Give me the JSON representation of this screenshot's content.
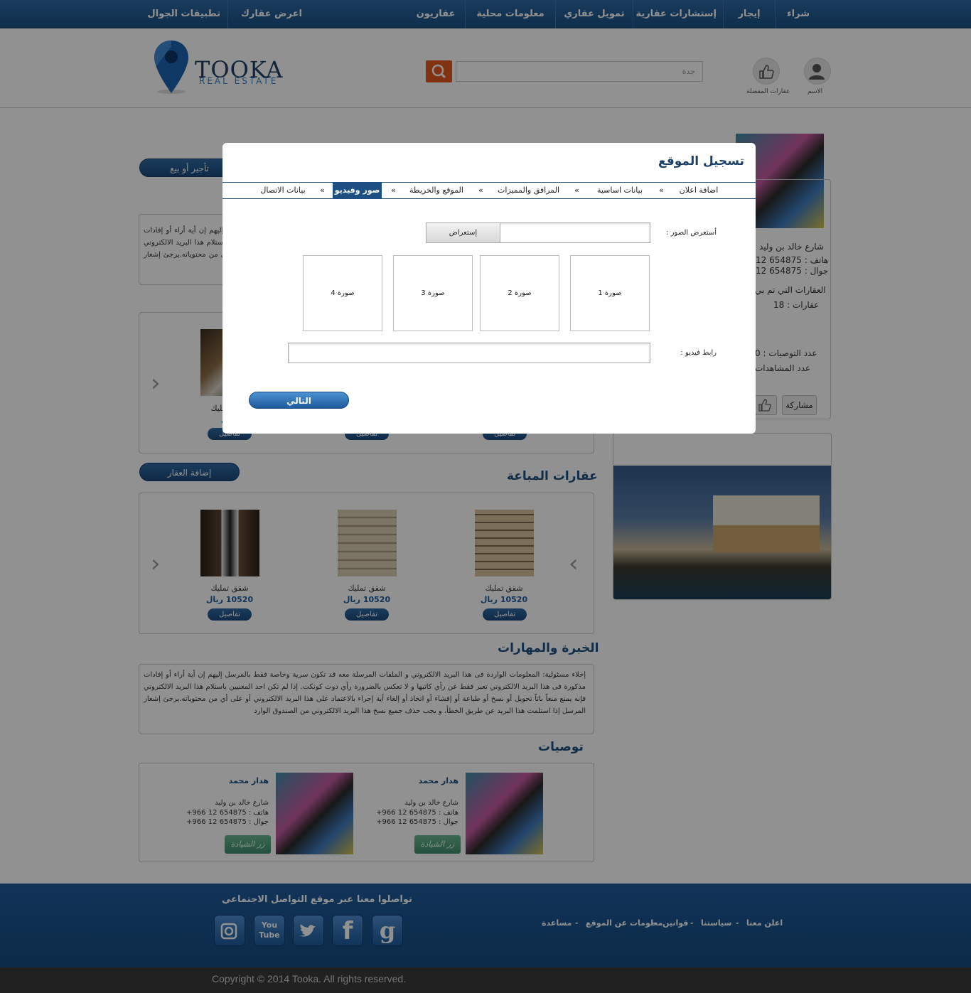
{
  "topnav": {
    "items": [
      "شراء",
      "إيجار",
      "إستشارات عقارية",
      "تمويل عقاري",
      "معلومات محلية",
      "عقاريون",
      "اعرض  عقارك",
      "تطبيقات الجوال"
    ]
  },
  "header": {
    "logo_main": "TOOKA",
    "logo_sub": "REAL ESTATE",
    "search_placeholder": "جدة",
    "user_label": "الاسم",
    "favorites_label": "عقارات المفضلة"
  },
  "main": {
    "rent_sell_button": "تأجير أو بيع",
    "add_property_button": "إضافة العقار",
    "sold_title": "عقارات المباعة",
    "experience_title": "الخبرة والمهارات",
    "recommendations_title": "توصيات",
    "disclaimer_text": "إخلاء مسئولية: المعلومات الواردة فى هذا البريد الالكتروني و الملفات المرسلة معه قد تكون سرية وخاصة فقط بالمرسل إليهم إن أية أراء أو إفادات مذكورة فى هذا البريد الالكتروني تعبر فقط عن رأي كاتبها و لا تعكس بالضرورة رأي دوت كونكت. إذا لم تكن احد المعنيين باستلام هذا البريد الالكتروني فإنه يمنع منعاً باتاً تحويل أو نسخ أو طباعة أو إفشاء أو اتخاذ أو إلغاء أية إجراء بالاعتماد على هذا البريد الالكتروني أو على أي من محتوياته.يرجئ إشعار المرسل إذا استلمت هذا البريد عن طريق الخطأ،  و يجب حذف جميع نسخ هذا البريد الالكتروني من الصندوق الوارد",
    "top_disclaimer_visible": "لمرسل إليهم إن أية أراء أو احد المعنيين باستلام هذا يد الالكتروني أو على أي كتروني من الصندوق الوارد",
    "properties": [
      {
        "name": "شقق تمليك",
        "price": "10520 ريال",
        "details": "تفاصيل"
      },
      {
        "name": "شقق تمليك",
        "price": "10520 ريال",
        "details": "تفاصيل"
      },
      {
        "name": "شقق تمليك",
        "price": "10520 ريال",
        "details": "تفاصيل"
      }
    ],
    "top_properties": [
      {
        "name": "شقق تمليك",
        "price": "ريال",
        "details": "تفاصيل"
      }
    ],
    "recommendations": [
      {
        "name": "هدار محمد",
        "street": "شارع خالد بن وليد",
        "phone": "هاتف : 654875 12 966+",
        "mobile": "جوال : 654875 12 966+",
        "visit": "زر الشيادة"
      },
      {
        "name": "هدار محمد",
        "street": "شارع خالد بن وليد",
        "phone": "هاتف : 654875 12 966+",
        "mobile": "جوال : 654875 12 966+",
        "visit": "زر الشيادة"
      }
    ]
  },
  "sidebar": {
    "street": "شارع خالد بن وليد",
    "phone": "هاتف : 654875 12",
    "mobile": "جوال : 654875 12",
    "sold_label": "العقارات التي تم بي",
    "properties_count": "عقارات  :   18",
    "recommend_count": "عدد التوصيات : 0",
    "views_count": "عدد المشاهدات",
    "share_button": "مشاركة"
  },
  "modal": {
    "title": "تسجيل الموقع",
    "tabs": [
      "اضافة اعلان",
      "بيانات اساسية",
      "المرافق والمميزات",
      "الموقع والخريطة",
      "صور وفيديو",
      "بيانات الاتصال"
    ],
    "active_tab": 4,
    "separator": "»",
    "browse_label": "أستعرض الصور :",
    "browse_button": "إستعراض",
    "photo_slots": [
      "صورة 1",
      "صورة 2",
      "صورة 3",
      "صورة 4"
    ],
    "video_label": "رابط فيديو :",
    "next_button": "التالي"
  },
  "footer": {
    "social_title": "تواصلوا معنا عبر موقع التواصل الاجتماعي",
    "links": [
      "اعلن معنا",
      "-",
      "سياستنا",
      "-",
      "قوانين",
      "-",
      "معلومات عن الموقع",
      "-",
      "مساعدة"
    ],
    "social_icons": [
      "instagram-icon",
      "youtube-icon",
      "twitter-icon",
      "facebook-icon",
      "google-icon"
    ],
    "youtube_text": "You Tube",
    "copyright": "Copyright © 2014 Tooka. All rights reserved."
  },
  "colors": {
    "brand_blue": "#1d4f82",
    "accent_orange": "#e4561e",
    "footer_blue": "#1e5c9c"
  }
}
